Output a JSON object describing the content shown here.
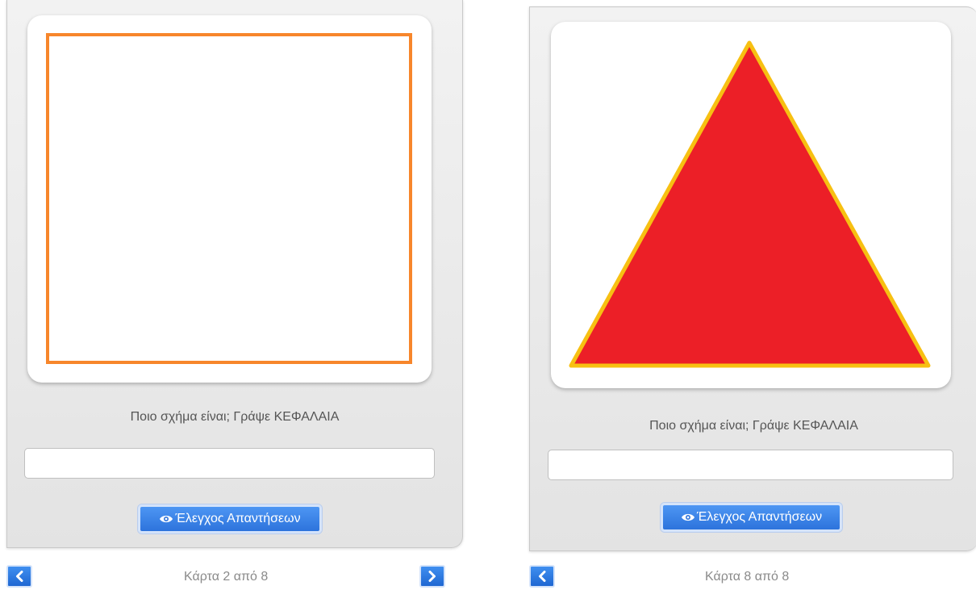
{
  "left_card": {
    "shape": "square",
    "stroke_color": "#f7862b",
    "fill_color": "#ffffff",
    "question": "Ποιο σχήμα είναι; Γράψε ΚΕΦΑΛΑΙΑ",
    "answer_value": "",
    "check_label": "Έλεγχος Απαντήσεων",
    "counter": "Κάρτα 2 από 8"
  },
  "right_card": {
    "shape": "triangle",
    "stroke_color": "#f7c012",
    "fill_color": "#ec1f27",
    "question": "Ποιο σχήμα είναι; Γράψε ΚΕΦΑΛΑΙΑ",
    "answer_value": "",
    "check_label": "Έλεγχος Απαντήσεων",
    "counter": "Κάρτα 8 από 8"
  },
  "icons": {
    "check": "eye-icon",
    "prev": "chevron-left-icon",
    "next": "chevron-right-icon"
  },
  "colors": {
    "button_blue": "#2d73dc"
  }
}
